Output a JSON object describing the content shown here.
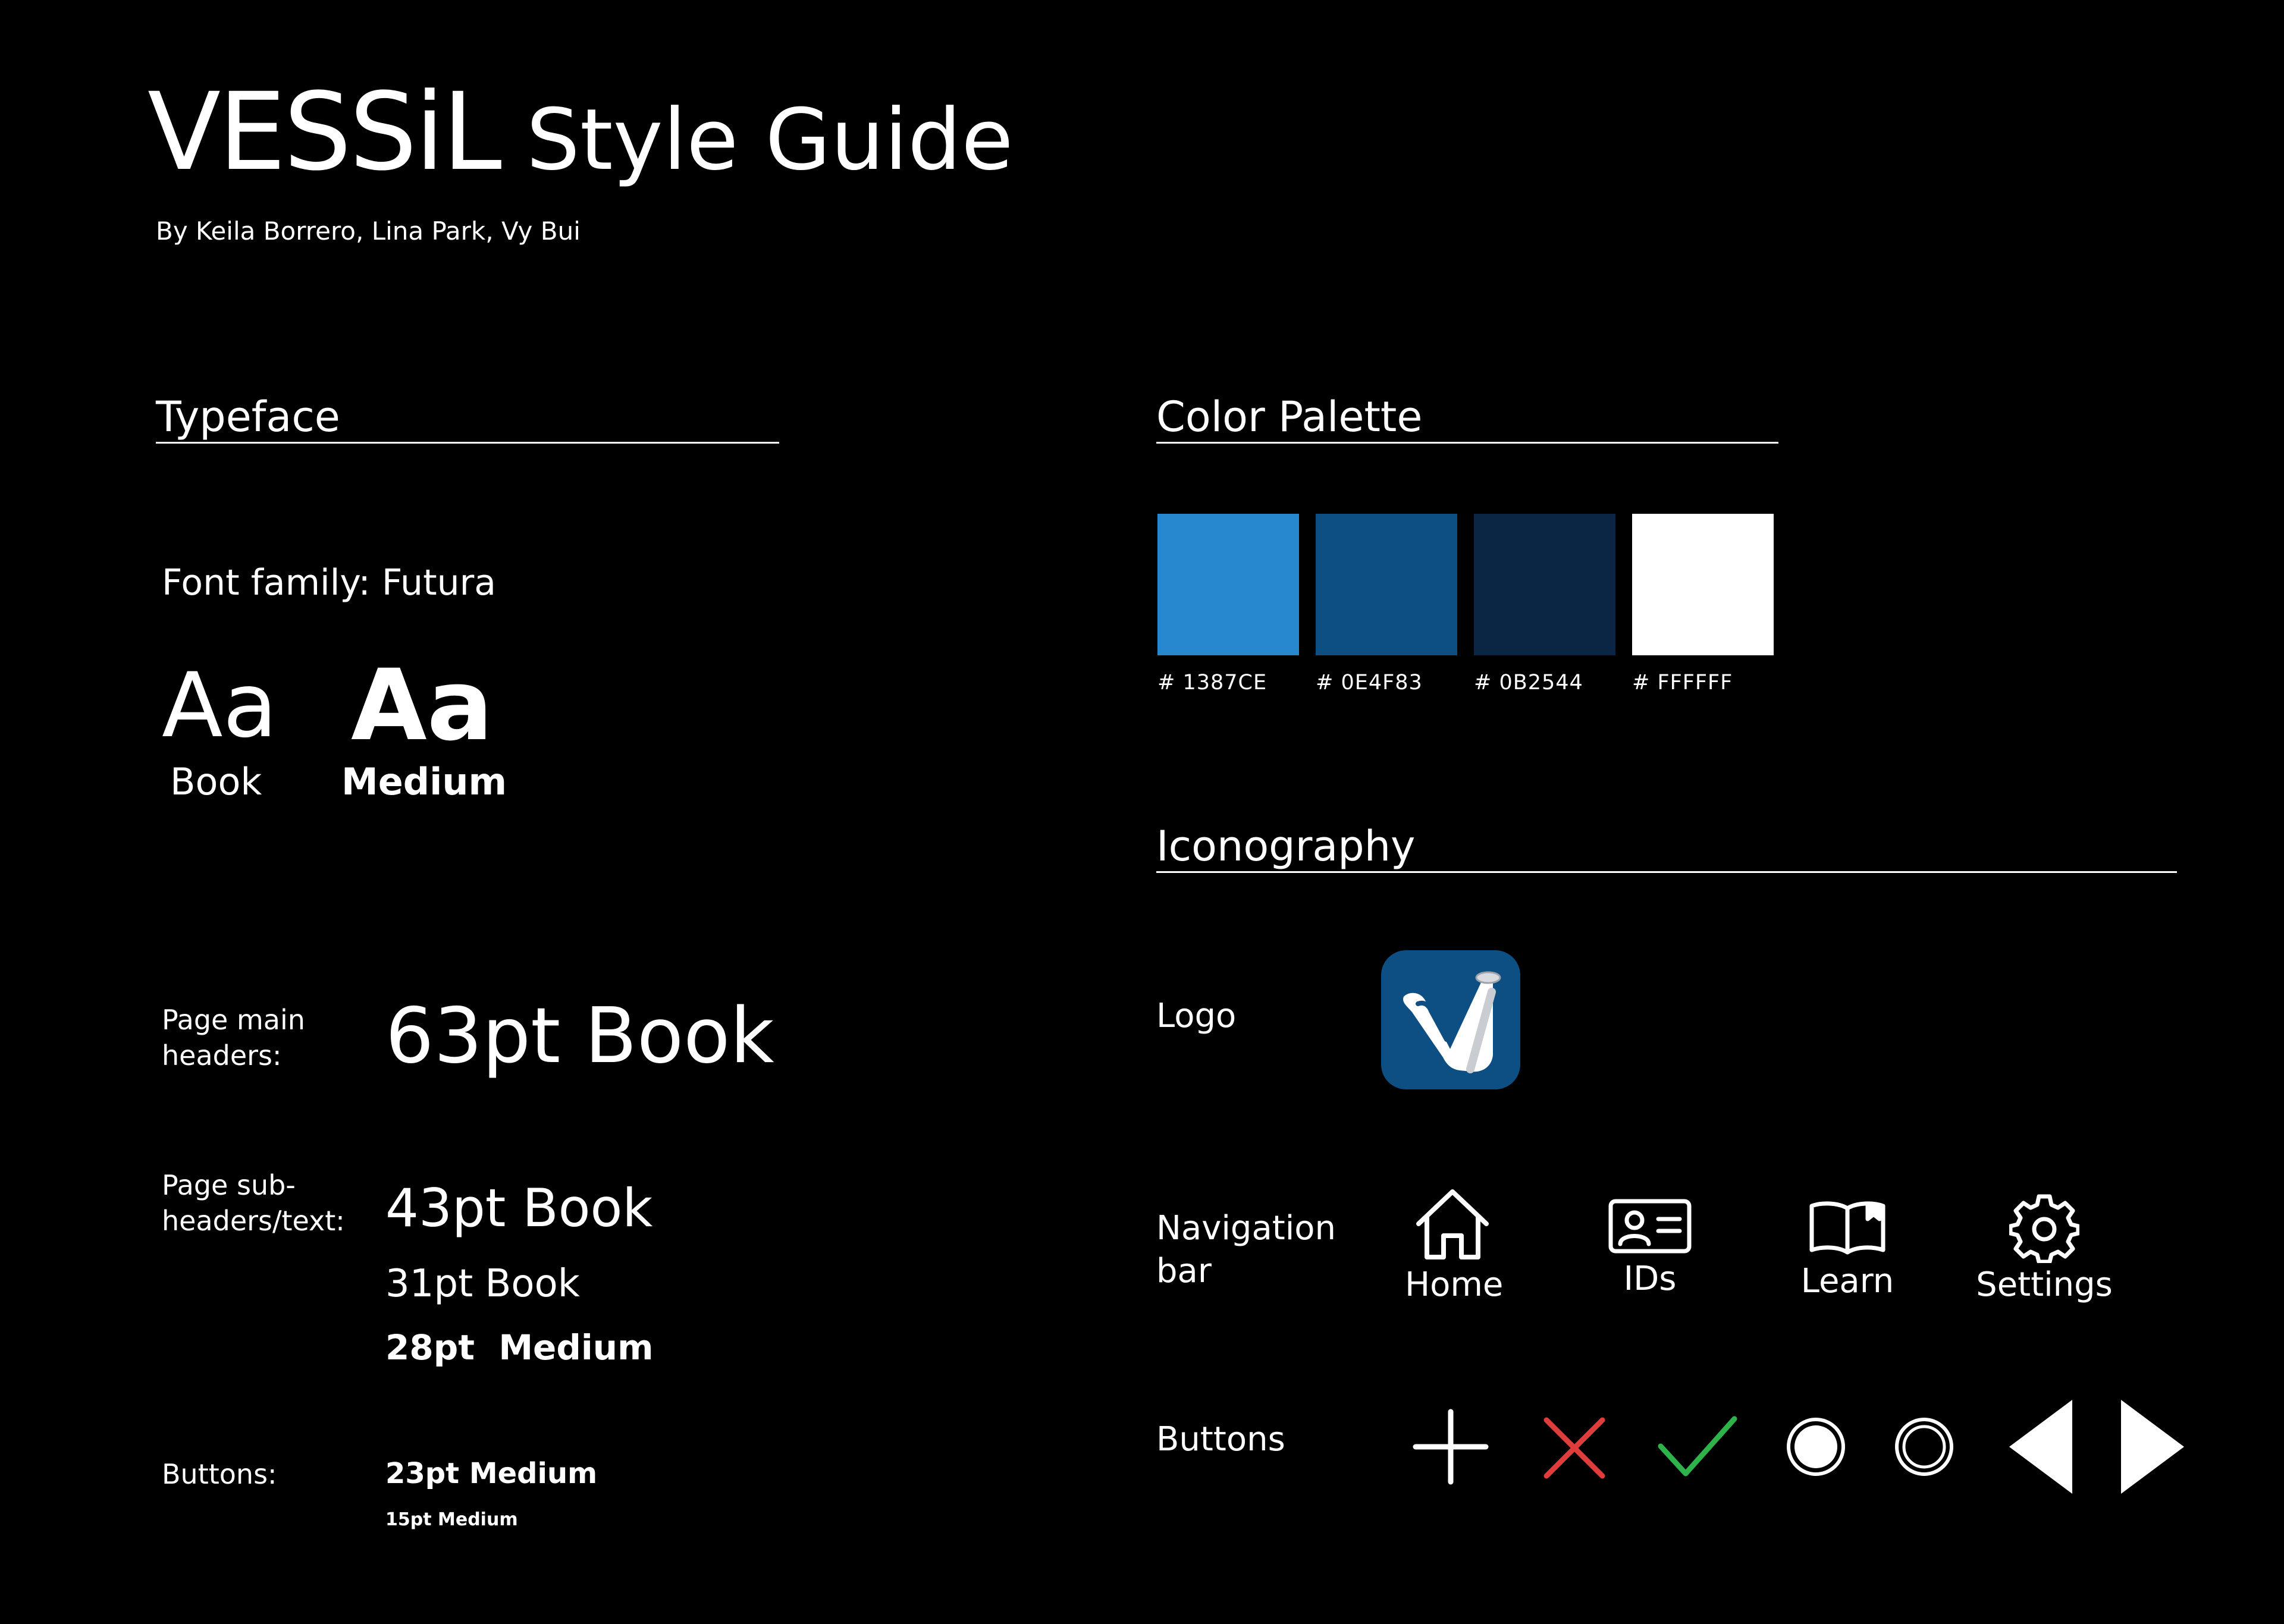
{
  "title": {
    "brand": "VESSiL",
    "suffix": "Style Guide"
  },
  "byline": "By Keila Borrero, Lina Park, Vy Bui",
  "typeface": {
    "header": "Typeface",
    "font_family": "Font family: Futura",
    "samples": [
      {
        "glyph": "Aa",
        "weight_label": "Book"
      },
      {
        "glyph": "Aa",
        "weight_label": "Medium"
      }
    ],
    "specs": {
      "main_label_1": "Page main",
      "main_label_2": "headers:",
      "main_value": "63pt Book",
      "sub_label_1": "Page sub-",
      "sub_label_2": "headers/text:",
      "sub_value_1": "43pt Book",
      "sub_value_2": "31pt Book",
      "sub_value_3": "28pt  Medium",
      "buttons_label": "Buttons:",
      "buttons_value_1": "23pt Medium",
      "buttons_value_2": "15pt Medium"
    }
  },
  "color_palette": {
    "header": "Color Palette",
    "swatches": [
      {
        "hex": "#1387CE",
        "label": "# 1387CE"
      },
      {
        "hex": "#0E4F83",
        "label": "# 0E4F83"
      },
      {
        "hex": "#0B2544",
        "label": "# 0B2544"
      },
      {
        "hex": "#FFFFFF",
        "label": "# FFFFFF"
      }
    ]
  },
  "iconography": {
    "header": "Iconography",
    "logo_label": "Logo",
    "nav_label_1": "Navigation",
    "nav_label_2": "bar",
    "nav_items": [
      {
        "icon": "home-icon",
        "label": "Home"
      },
      {
        "icon": "id-card-icon",
        "label": "IDs"
      },
      {
        "icon": "book-icon",
        "label": "Learn"
      },
      {
        "icon": "gear-icon",
        "label": "Settings"
      }
    ],
    "buttons_label": "Buttons",
    "buttons": [
      "plus-icon",
      "close-icon",
      "check-icon",
      "radio-filled-icon",
      "radio-empty-icon",
      "arrow-left-icon",
      "arrow-right-icon"
    ],
    "colors": {
      "close": "#E03C3C",
      "check": "#2DB34A",
      "logo_bg": "#0E4F83"
    }
  }
}
